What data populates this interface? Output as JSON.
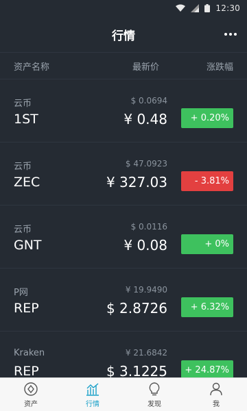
{
  "status_bar": {
    "time": "12:30"
  },
  "header": {
    "title": "行情"
  },
  "columns": {
    "name": "资产名称",
    "price": "最新价",
    "change": "涨跌幅"
  },
  "rows": [
    {
      "exchange": "云币",
      "symbol": "1ST",
      "sub_price": "$ 0.0694",
      "price": "¥ 0.48",
      "change": "+ 0.20%",
      "trend": "up"
    },
    {
      "exchange": "云币",
      "symbol": "ZEC",
      "sub_price": "$ 47.0923",
      "price": "¥ 327.03",
      "change": "- 3.81%",
      "trend": "down"
    },
    {
      "exchange": "云币",
      "symbol": "GNT",
      "sub_price": "$ 0.0116",
      "price": "¥ 0.08",
      "change": "+ 0%",
      "trend": "up"
    },
    {
      "exchange": "P网",
      "symbol": "REP",
      "sub_price": "¥ 19.9490",
      "price": "$ 2.8726",
      "change": "+ 6.32%",
      "trend": "up"
    },
    {
      "exchange": "Kraken",
      "symbol": "REP",
      "sub_price": "¥ 21.6842",
      "price": "$ 3.1225",
      "change": "+ 24.87%",
      "trend": "up"
    }
  ],
  "nav": {
    "items": [
      {
        "label": "资产",
        "icon": "assets-icon",
        "active": false
      },
      {
        "label": "行情",
        "icon": "market-chart-icon",
        "active": true
      },
      {
        "label": "发现",
        "icon": "lightbulb-icon",
        "active": false
      },
      {
        "label": "我",
        "icon": "user-icon",
        "active": false
      }
    ]
  },
  "colors": {
    "background": "#252b33",
    "up": "#3ec15e",
    "down": "#e34040",
    "accent": "#1aa0c8"
  }
}
